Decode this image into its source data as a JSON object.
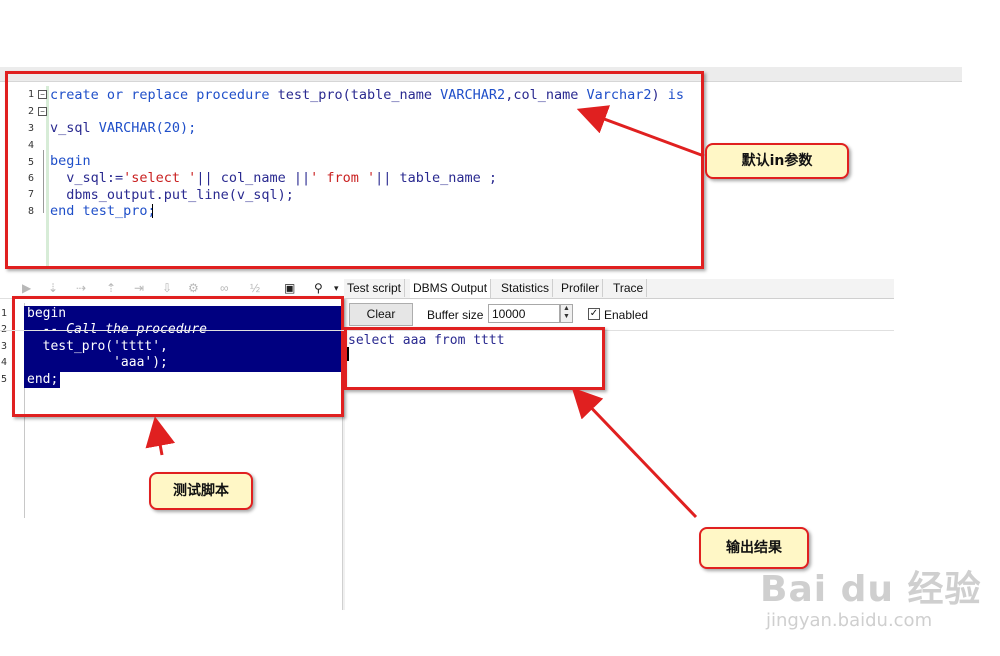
{
  "editor": {
    "line_numbers": [
      "1",
      "2",
      "3",
      "4",
      "5",
      "6",
      "7",
      "8"
    ],
    "lines": {
      "l1": {
        "kw1": "create or replace procedure ",
        "name": "test_pro",
        "p1": "(table_name ",
        "t1": "VARCHAR2",
        "p2": ",col_name ",
        "t2": "Varchar2",
        "p3": ") ",
        "is": "is"
      },
      "l3": {
        "a": "v_sql ",
        "b": "VARCHAR(20);"
      },
      "l5": {
        "a": "begin"
      },
      "l6": {
        "a": "  v_sql:=",
        "b": "'select '",
        "c": "|| col_name ||",
        "d": "' from '",
        "e": "|| table_name ;"
      },
      "l7": {
        "a": "  dbms_output.put_line(v_sql);"
      },
      "l8": {
        "a": "end test_pro;"
      }
    }
  },
  "test_script": {
    "line_numbers": [
      "1",
      "2",
      "3",
      "4",
      "5"
    ],
    "lines": [
      "begin",
      "  -- Call the procedure",
      "  test_pro('tttt',",
      "           'aaa');",
      "end;"
    ]
  },
  "tabs": [
    "Test script",
    "DBMS Output",
    "Statistics",
    "Profiler",
    "Trace"
  ],
  "output_panel": {
    "clear_label": "Clear",
    "buffer_label": "Buffer size",
    "buffer_value": "10000",
    "enabled_label": "Enabled",
    "enabled_checked": true,
    "output_text": "select aaa from tttt"
  },
  "callouts": {
    "default_in": "默认in参数",
    "test_script": "测试脚本",
    "output_result": "输出结果"
  },
  "watermark": {
    "brand": "Bai du 经验",
    "url": "jingyan.baidu.com"
  },
  "colors": {
    "annotation_red": "#e02020",
    "callout_fill": "#fff7c6",
    "selection_blue": "#000080",
    "keyword_blue": "#1f4fc9"
  }
}
